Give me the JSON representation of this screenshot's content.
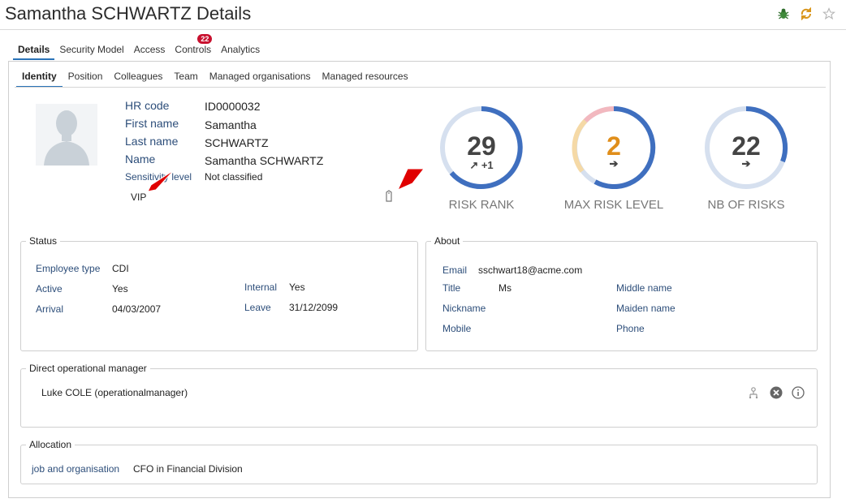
{
  "page_title": "Samantha SCHWARTZ Details",
  "header_icons": [
    "bug-icon",
    "sync-icon",
    "star-icon"
  ],
  "main_tabs": [
    {
      "label": "Details",
      "active": true
    },
    {
      "label": "Security Model"
    },
    {
      "label": "Access"
    },
    {
      "label": "Controls",
      "badge": "22"
    },
    {
      "label": "Analytics"
    }
  ],
  "sub_tabs": [
    {
      "label": "Identity",
      "active": true
    },
    {
      "label": "Position"
    },
    {
      "label": "Colleagues"
    },
    {
      "label": "Team"
    },
    {
      "label": "Managed organisations"
    },
    {
      "label": "Managed resources"
    }
  ],
  "identity": {
    "hr_code_label": "HR code",
    "hr_code": "ID0000032",
    "first_name_label": "First name",
    "first_name": "Samantha",
    "last_name_label": "Last name",
    "last_name": "SCHWARTZ",
    "name_label": "Name",
    "name": "Samantha SCHWARTZ",
    "sensitivity_label": "Sensitivity level",
    "sensitivity": "Not classified",
    "vip": "VIP"
  },
  "gauges": [
    {
      "value": "29",
      "trend": "↗ +1",
      "caption": "RISK RANK",
      "color": "#444444"
    },
    {
      "value": "2",
      "trend": "➔",
      "caption": "MAX RISK LEVEL",
      "color": "#e08e1a"
    },
    {
      "value": "22",
      "trend": "➔",
      "caption": "NB OF RISKS",
      "color": "#444444"
    }
  ],
  "status": {
    "legend": "Status",
    "employee_type_label": "Employee type",
    "employee_type": "CDI",
    "active_label": "Active",
    "active": "Yes",
    "arrival_label": "Arrival",
    "arrival": "04/03/2007",
    "internal_label": "Internal",
    "internal": "Yes",
    "leave_label": "Leave",
    "leave": "31/12/2099"
  },
  "about": {
    "legend": "About",
    "email_label": "Email",
    "email": "sschwart18@acme.com",
    "title_label": "Title",
    "title": "Ms",
    "nickname_label": "Nickname",
    "mobile_label": "Mobile",
    "middle_name_label": "Middle name",
    "maiden_name_label": "Maiden name",
    "phone_label": "Phone"
  },
  "manager": {
    "legend": "Direct operational manager",
    "name": "Luke COLE (operationalmanager)"
  },
  "allocation": {
    "legend": "Allocation",
    "label": "job and organisation",
    "value": "CFO in Financial Division"
  },
  "colors": {
    "accent": "#2a73b8",
    "gauge_blue": "#3f6fbf",
    "gauge_track": "#d6e0ef",
    "badge": "#c8102e",
    "arrow": "#e00000"
  }
}
